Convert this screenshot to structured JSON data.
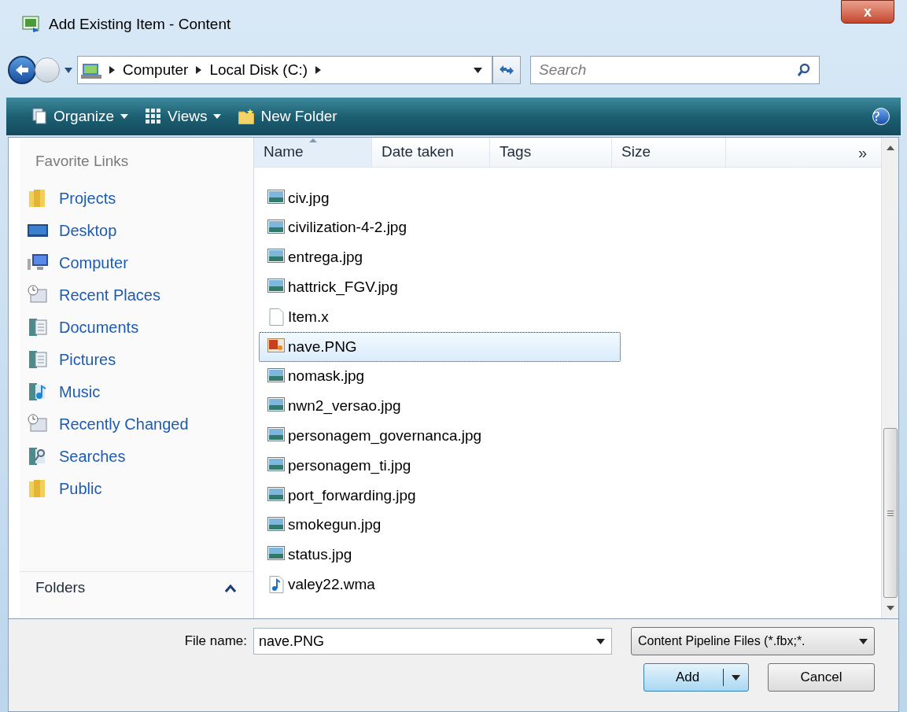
{
  "window": {
    "title": "Add Existing Item - Content",
    "close": "x"
  },
  "address": {
    "crumbs": [
      "Computer",
      "Local Disk (C:)"
    ],
    "search_placeholder": "Search"
  },
  "toolbar": {
    "items": [
      {
        "label": "Organize",
        "kind": "pages"
      },
      {
        "label": "Views",
        "kind": "grid"
      },
      {
        "label": "New Folder",
        "kind": "folder"
      }
    ]
  },
  "sidebar": {
    "heading": "Favorite Links",
    "items": [
      {
        "label": "Projects",
        "kind": "folder"
      },
      {
        "label": "Desktop",
        "kind": "desktop"
      },
      {
        "label": "Computer",
        "kind": "computer"
      },
      {
        "label": "Recent Places",
        "kind": "recent"
      },
      {
        "label": "Documents",
        "kind": "library"
      },
      {
        "label": "Pictures",
        "kind": "library"
      },
      {
        "label": "Music",
        "kind": "music"
      },
      {
        "label": "Recently Changed",
        "kind": "recent"
      },
      {
        "label": "Searches",
        "kind": "search"
      },
      {
        "label": "Public",
        "kind": "folder"
      }
    ],
    "folders": {
      "label": "Folders",
      "expanded": false
    }
  },
  "table": {
    "columns": [
      "Name",
      "Date taken",
      "Tags",
      "Size"
    ],
    "more": "»",
    "rows": [
      {
        "name": "civ.jpg",
        "kind": "image",
        "selected": false
      },
      {
        "name": "civilization-4-2.jpg",
        "kind": "image",
        "selected": false
      },
      {
        "name": "entrega.jpg",
        "kind": "image",
        "selected": false
      },
      {
        "name": "hattrick_FGV.jpg",
        "kind": "image",
        "selected": false
      },
      {
        "name": "Item.x",
        "kind": "file",
        "selected": false
      },
      {
        "name": "nave.PNG",
        "kind": "png",
        "selected": true
      },
      {
        "name": "nomask.jpg",
        "kind": "image",
        "selected": false
      },
      {
        "name": "nwn2_versao.jpg",
        "kind": "image",
        "selected": false
      },
      {
        "name": "personagem_governanca.jpg",
        "kind": "image",
        "selected": false
      },
      {
        "name": "personagem_ti.jpg",
        "kind": "image",
        "selected": false
      },
      {
        "name": "port_forwarding.jpg",
        "kind": "image",
        "selected": false
      },
      {
        "name": "smokegun.jpg",
        "kind": "image",
        "selected": false
      },
      {
        "name": "status.jpg",
        "kind": "image",
        "selected": false
      },
      {
        "name": "valey22.wma",
        "kind": "audio",
        "selected": false
      }
    ]
  },
  "footer": {
    "file_name_label": "File name:",
    "file_name": "nave.PNG",
    "file_type": "Content Pipeline Files (*.fbx;*.",
    "buttons": [
      "Add",
      "Cancel"
    ]
  }
}
